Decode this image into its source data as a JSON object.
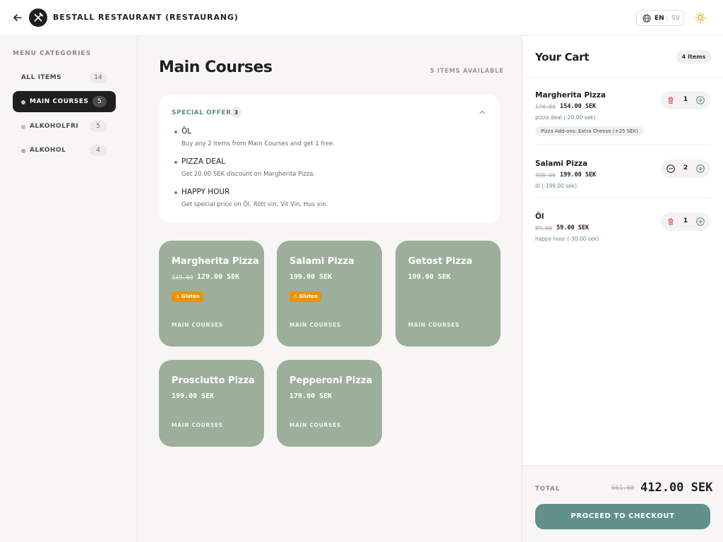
{
  "header": {
    "title": "BESTALL RESTAURANT (RESTAURANG)",
    "lang_active": "EN",
    "lang_separator": "|",
    "lang_other": "SV",
    "icons": [
      "back-arrow-icon",
      "utensils-logo-icon",
      "globe-icon",
      "sun-icon"
    ]
  },
  "sidebar": {
    "heading": "MENU CATEGORIES",
    "items": [
      {
        "label": "ALL ITEMS",
        "count": "14"
      },
      {
        "label": "MAIN COURSES",
        "count": "5",
        "dot_color": "#c9c7c3",
        "active": true
      },
      {
        "label": "ALKOHOLFRI",
        "count": "5",
        "dot_color": "#c9b8a3"
      },
      {
        "label": "ALKOHOL",
        "count": "4",
        "dot_color": "#d49a9a"
      }
    ]
  },
  "main": {
    "title": "Main Courses",
    "items_available": "5 ITEMS AVAILABLE",
    "offers": {
      "title": "SPECIAL OFFERS",
      "count": "3",
      "items": [
        {
          "name": "ÖL",
          "desc": "Buy any 2 items from Main Courses and get 1 free."
        },
        {
          "name": "PIZZA DEAL",
          "desc": "Get 20.00 SEK discount on Margherita Pizza."
        },
        {
          "name": "HAPPY HOUR",
          "desc": "Get special price on Öl, Rött vin, Vit Vin, Hus vin."
        }
      ]
    },
    "products": [
      {
        "name": "Margherita Pizza",
        "old_price": "149.00",
        "price": "129.00 SEK",
        "badge": "⚠ Gluten",
        "category": "MAIN COURSES"
      },
      {
        "name": "Salami Pizza",
        "price": "199.00 SEK",
        "badge": "⚠ Gluten",
        "category": "MAIN COURSES"
      },
      {
        "name": "Getost Pizza",
        "price": "199.00 SEK",
        "category": "MAIN COURSES"
      },
      {
        "name": "Prosciutto Pizza",
        "price": "199.00 SEK",
        "category": "MAIN COURSES"
      },
      {
        "name": "Pepperoni Pizza",
        "price": "179.00 SEK",
        "category": "MAIN COURSES"
      }
    ]
  },
  "cart": {
    "title": "Your Cart",
    "count": "4 Items",
    "items": [
      {
        "name": "Margherita Pizza",
        "old_price": "174.00",
        "price": "154.00 SEK",
        "note": "pizza deal (-20.00 sek)",
        "addon": "Pizza Add-ons: Extra Cheese (+25 SEK)",
        "qty": "1",
        "left_icon": "trash-icon"
      },
      {
        "name": "Salami Pizza",
        "old_price": "398.00",
        "price": "199.00 SEK",
        "note": "öl (-199.00 sek)",
        "qty": "2",
        "left_icon": "minus-circle-icon"
      },
      {
        "name": "Öl",
        "old_price": "89.00",
        "price": "59.00 SEK",
        "note": "happy hour (-30.00 sek)",
        "qty": "1",
        "left_icon": "trash-icon"
      }
    ],
    "total_label": "TOTAL",
    "total_old": "661.00",
    "total_new": "412.00 SEK",
    "checkout_label": "PROCEED TO CHECKOUT"
  },
  "colors": {
    "accent": "#5e8a84",
    "card": "#9caf9a",
    "checkout": "#62908d",
    "badge": "#e8920f",
    "dark": "#1f1f1f"
  }
}
